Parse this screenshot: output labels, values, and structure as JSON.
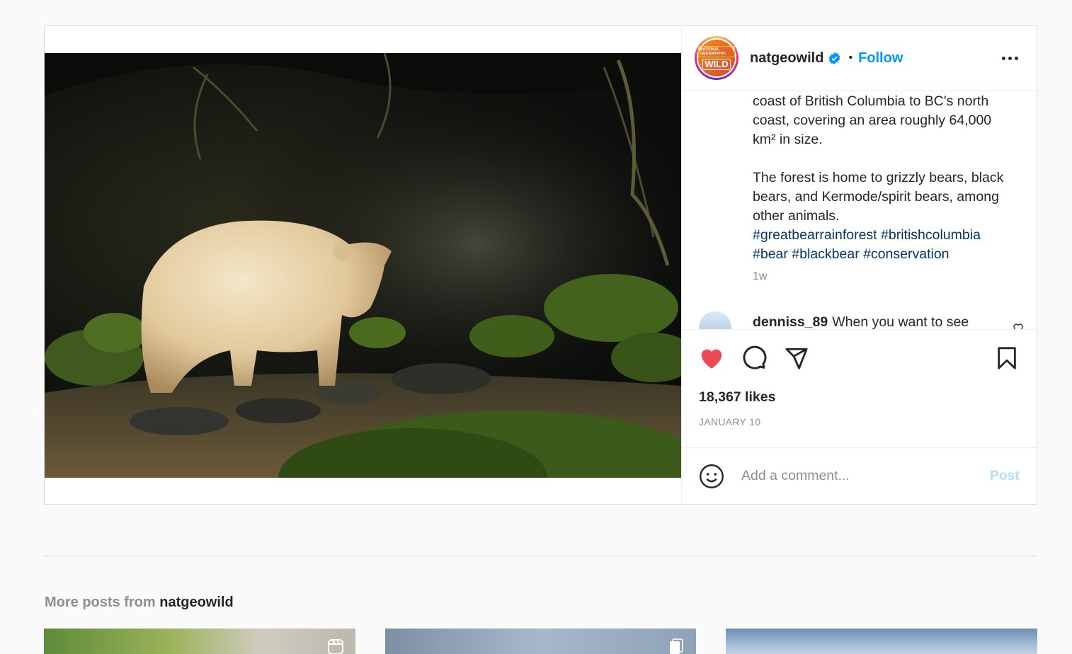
{
  "post": {
    "username": "natgeowild",
    "follow_label": "Follow",
    "separator": "•",
    "avatar": {
      "small_text": "NATIONAL GEOGRAPHIC",
      "big_text": "WILD"
    },
    "caption": {
      "para1": "coast of British Columbia to BC's north coast, covering an area roughly 64,000 km² in size.",
      "para2": "The forest is home to grizzly bears, black bears, and Kermode/spirit bears, among other animals.",
      "hashtags": "#greatbearrainforest #britishcolumbia #bear #blackbear #conservation"
    },
    "time_ago": "1w",
    "first_comment": {
      "username": "denniss_89",
      "text": "When you want to see"
    },
    "likes": "18,367 likes",
    "date": "JANUARY 10",
    "comment_placeholder": "Add a comment...",
    "post_label": "Post",
    "liked": true
  },
  "more_posts": {
    "prefix": "More posts from",
    "username": "natgeowild"
  },
  "colors": {
    "accent": "#0095f6",
    "like": "#ed4956",
    "hashtag": "#00376b",
    "muted": "#8e8e8e"
  },
  "icons": [
    "verified-badge-icon",
    "more-options-icon",
    "heart-filled-icon",
    "comment-icon",
    "share-icon",
    "bookmark-icon",
    "emoji-icon",
    "reels-icon",
    "carousel-icon"
  ]
}
